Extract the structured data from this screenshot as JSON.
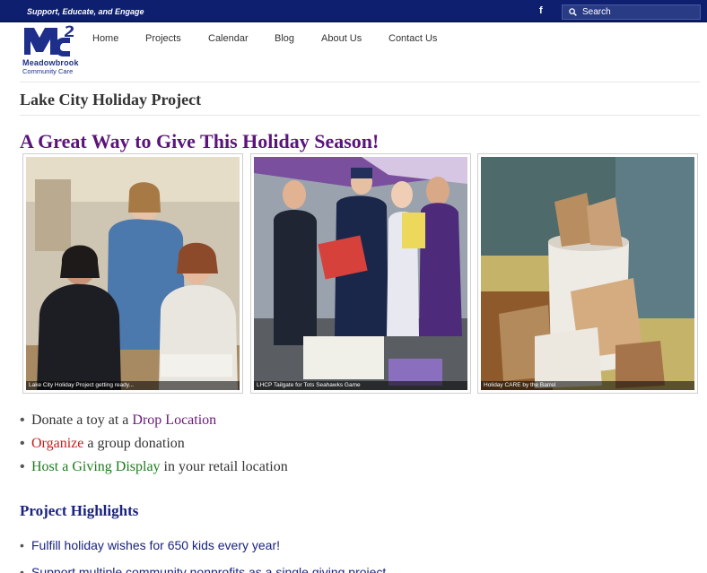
{
  "topbar": {
    "tagline": "Support, Educate, and Engage",
    "facebook_glyph": "f",
    "search_placeholder": "Search"
  },
  "logo": {
    "line1": "Meadowbrook",
    "line2": "Community Care",
    "brand_color": "#1d2f8a"
  },
  "nav": {
    "items": [
      "Home",
      "Projects",
      "Calendar",
      "Blog",
      "About Us",
      "Contact Us"
    ]
  },
  "page": {
    "title": "Lake City Holiday Project",
    "headline": "A Great Way to Give This Holiday Season!",
    "headline_color": "#5b157a"
  },
  "photos": [
    {
      "caption": "Lake City Holiday Project getting ready..."
    },
    {
      "caption": "LHCP Tailgate for Tots Seahawks Game"
    },
    {
      "caption": "Holiday CARE by the Barrel"
    }
  ],
  "ways": [
    {
      "prefix": "Donate a toy at a ",
      "link": "Drop Location",
      "suffix": ""
    },
    {
      "prefix": "",
      "link": "Organize",
      "suffix": " a group donation"
    },
    {
      "prefix": "",
      "link": "Host a Giving Display",
      "suffix": " in your retail location"
    }
  ],
  "highlights": {
    "title": "Project Highlights",
    "items": [
      "Fulfill holiday wishes for 650 kids every year!",
      "Support multiple community nonprofits as a single giving project"
    ]
  },
  "colors": {
    "topbar": "#0d1f6e",
    "link_purple": "#6b1a7a",
    "link_red": "#c41e1e",
    "link_green": "#1f7a1f",
    "highlight_text": "#1a237e"
  }
}
